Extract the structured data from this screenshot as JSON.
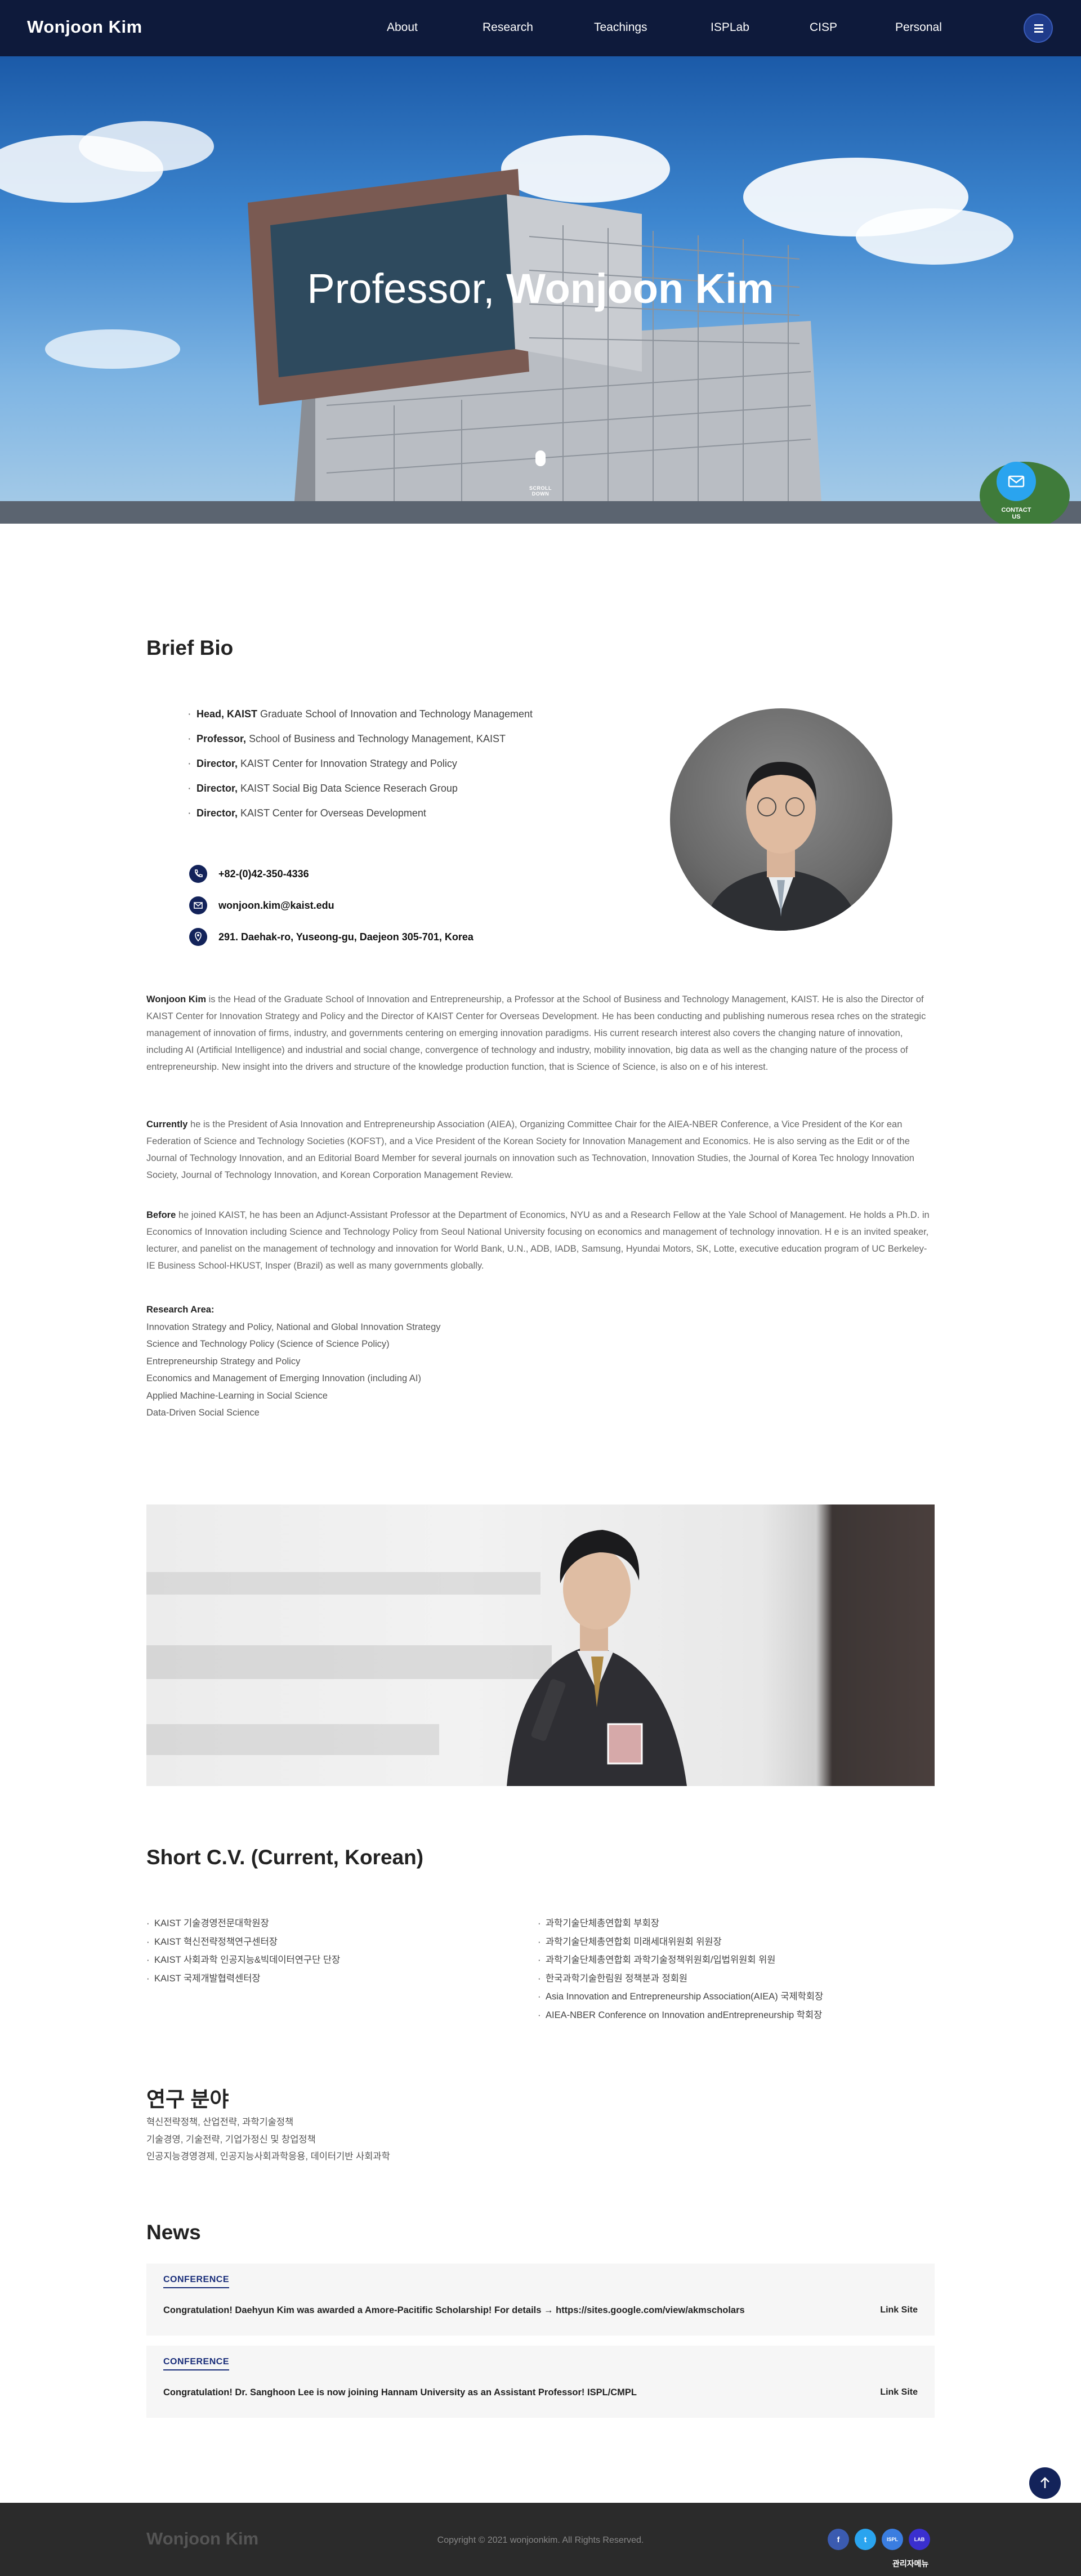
{
  "header": {
    "brand": "Wonjoon Kim",
    "nav": [
      "About",
      "Research",
      "Teachings",
      "ISPLab",
      "CISP",
      "Personal"
    ]
  },
  "hero": {
    "title_prefix": "Professor,",
    "title_name": "Wonjoon Kim",
    "scroll_label": "SCROLL DOWN",
    "contact_label": "CONTACT US"
  },
  "bio": {
    "title_bold": "Brief",
    "title_rest": "Bio",
    "roles": [
      {
        "bold": "Head, KAIST",
        "text": "Graduate School of Innovation and Technology Management"
      },
      {
        "bold": "Professor,",
        "text": "School of Business and Technology Management, KAIST"
      },
      {
        "bold": "Director,",
        "text": "KAIST Center for Innovation Strategy and Policy"
      },
      {
        "bold": "Director,",
        "text": "KAIST Social Big Data Science Reserach Group"
      },
      {
        "bold": "Director,",
        "text": "KAIST Center for Overseas Development"
      }
    ],
    "phone": "+82-(0)42-350-4336",
    "email": "wonjoon.kim@kaist.edu",
    "address": "291. Daehak-ro, Yuseong-gu, Daejeon 305-701, Korea",
    "p1_lead": "Wonjoon Kim",
    "p1": " is the Head of the Graduate School of Innovation and Entrepreneurship, a Professor at the School of Business and Technology Management, KAIST. He is also the Director of KAIST Center for Innovation Strategy and Policy and the Director of KAIST Center for Overseas Development. He has been conducting and publishing numerous resea rches on the strategic management of innovation of firms, industry, and governments centering on emerging innovation paradigms. His current research interest also covers the changing nature of innovation, including AI (Artificial Intelligence) and industrial and social change, convergence of technology and industry, mobility innovation, big data as well as the changing nature of the process of entrepreneurship. New insight into the drivers and structure of the knowledge production function, that is Science of Science, is also on e of his interest.",
    "p2_lead": "Currently",
    "p2": " he is the President of Asia Innovation and Entrepreneurship Association (AIEA), Organizing Committee Chair for the AIEA-NBER Conference, a Vice President of the Kor ean Federation of Science and Technology Societies (KOFST), and a Vice President of the Korean Society for Innovation Management and Economics. He is also serving as the Edit or of the Journal of Technology Innovation, and an Editorial Board Member for several journals on innovation such as Technovation, Innovation Studies, the Journal of Korea Tec hnology Innovation Society, Journal of Technology Innovation, and Korean Corporation Management Review.",
    "p3_lead": "Before",
    "p3": " he joined KAIST, he has been an Adjunct-Assistant Professor at the Department of Economics, NYU as and a Research Fellow at the Yale School of Management. He holds a Ph.D. in Economics of Innovation including Science and Technology Policy from Seoul National University focusing on economics and management of technology innovation. H e is an invited speaker, lecturer, and panelist on the management of technology and innovation for World Bank, U.N., ADB, IADB, Samsung, Hyundai Motors, SK, Lotte, executive education program of UC Berkeley-IE Business School-HKUST, Insper (Brazil) as well as many governments globally.",
    "research_area_title": "Research Area:",
    "research_areas": [
      "Innovation Strategy and Policy, National and Global Innovation Strategy",
      "Science and Technology Policy (Science of Science Policy)",
      "Entrepreneurship Strategy and Policy",
      "Economics and Management of Emerging Innovation (including AI)",
      "Applied Machine-Learning in Social Science",
      "Data-Driven Social Science"
    ]
  },
  "cv": {
    "title_bold": "Short C.V.",
    "title_rest": "(Current, Korean)",
    "left": [
      "KAIST 기술경영전문대학원장",
      "KAIST 혁신전략정책연구센터장",
      "KAIST 사회과학 인공지능&빅데이터연구단 단장",
      "KAIST 국제개발협력센터장"
    ],
    "right": [
      "과학기술단체총연합회 부회장",
      "과학기술단체총연합회 미래세대위원회 위원장",
      "과학기술단체총연합회 과학기술정책위원회/입법위원회 위원",
      "한국과학기술한림원 정책분과 정회원",
      "Asia Innovation and Entrepreneurship Association(AIEA) 국제학회장",
      "AIEA-NBER Conference on Innovation andEntrepreneurship 학회장"
    ]
  },
  "fields": {
    "title": "연구 분야",
    "items": [
      "혁신전략정책, 산업전략, 과학기술정책",
      "기술경영, 기술전략, 기업가정신 및 창업정책",
      "인공지능경영경제, 인공지능사회과학응용, 데이터기반 사회과학"
    ]
  },
  "news": {
    "title": "News",
    "items": [
      {
        "tag": "CONFERENCE",
        "text": "Congratulation! Daehyun Kim was awarded a Amore-Pacitific Scholarship! For details → https://sites.google.com/view/akmscholars",
        "link": "Link Site"
      },
      {
        "tag": "CONFERENCE",
        "text": "Congratulation!  Dr. Sanghoon Lee is now joining Hannam University as an Assistant Professor!  ISPL/CMPL",
        "link": "Link Site"
      }
    ]
  },
  "footer": {
    "brand": "Wonjoon Kim",
    "copyright": "Copyright © 2021 wonjoonkim. All Rights Reserved.",
    "social": [
      "f",
      "t",
      "ISPL",
      "LAB"
    ],
    "admin": "관리자메뉴"
  },
  "colors": {
    "header_bg": "#0e1a3b",
    "accent_navy": "#13235a",
    "contact_fab": "#2aa4ef",
    "footer_bg": "#2b2b2b"
  }
}
